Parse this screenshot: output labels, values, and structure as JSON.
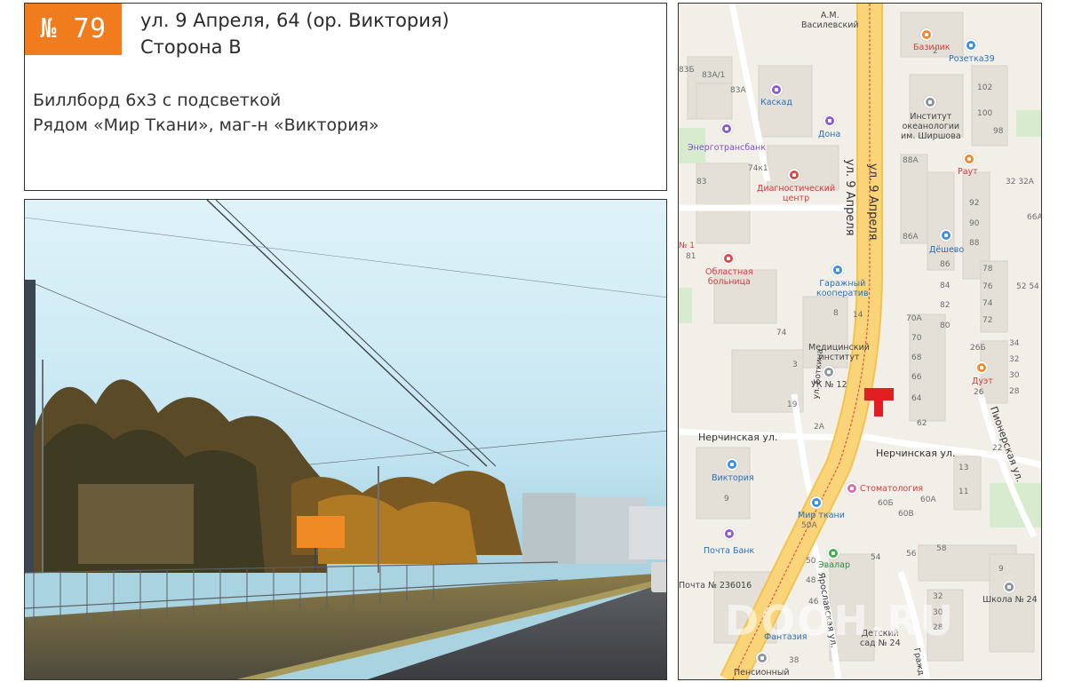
{
  "header": {
    "number": "№ 79",
    "address_line1": "ул. 9 Апреля, 64 (ор. Виктория)",
    "address_line2": "Сторона В",
    "description_line1": "Биллборд 6x3 с подсветкой",
    "description_line2": "Рядом «Мир Ткани», маг-н «Виктория»"
  },
  "colors": {
    "accent": "#f07c1e",
    "billboard": "#f08a24",
    "map_road": "#f9d479",
    "map_marker": "#e02020"
  },
  "map": {
    "streets": {
      "main": "ул. 9 Апреля",
      "nerchinskaya_left": "Нерчинская ул.",
      "nerchinskaya_right": "Нерчинская ул.",
      "pionerskaya": "Пионерская ул.",
      "botkina": "ул. Боткина",
      "yaroslavskaya": "Ярославская ул.",
      "grazhd": "Гражд"
    },
    "pois": {
      "vasilevsky": "А.М.\nВасилевский",
      "bazilik": "Базилик",
      "rozetka": "Розетка39",
      "kaskad": "Каскад",
      "dona": "Дона",
      "institute": "Институт\nокеанологии\nим. Ширшова",
      "energo": "Энерготрансбанк",
      "diagnost": "Диагностический\nцентр",
      "raut": "Раут",
      "deshevo": "Дёшево",
      "hospital": "Областная\nбольница",
      "garage": "Гаражный\nкооператив",
      "med_institute": "Медицинский\nинститут",
      "uk12": "УК № 12",
      "duet": "Дуэт",
      "viktoria": "Виктория",
      "stomatology": "Стоматология",
      "mir_tkani": "Мир ткани",
      "pochta_bank": "Почта Банк",
      "evalar": "Эвалар",
      "pochta": "Почта № 236016",
      "school": "Школа № 24",
      "fantasia": "Фантазия",
      "kindergarten": "Детский\nсад № 24",
      "pension": "Пенсионный"
    },
    "numbers": {
      "n83b": "83Б",
      "n83a1": "83А/1",
      "n83a": "83А",
      "n83": "83",
      "n74k1": "74к1",
      "n81": "81",
      "n74": "74",
      "n3": "3",
      "n19": "19",
      "n2a": "2А",
      "n8": "8",
      "n14": "14",
      "n88a": "88А",
      "n86a": "86А",
      "n86": "86",
      "n84": "84",
      "n82": "82",
      "n80": "80",
      "n70a": "70А",
      "n70": "70",
      "n68": "68",
      "n66": "66",
      "n64": "64",
      "n62": "62",
      "n2": "2",
      "n102": "102",
      "n100": "100",
      "n98": "98",
      "n92": "92",
      "n90": "90",
      "n88": "88",
      "n78": "78",
      "n76": "76",
      "n74b": "74",
      "n72": "72",
      "n26b": "26Б",
      "n26": "26",
      "n34": "34",
      "n32": "32",
      "n30": "30",
      "n28": "28",
      "n22": "22",
      "n13": "13",
      "n11": "11",
      "n60b": "60Б",
      "n60v": "60В",
      "n60a": "60А",
      "n50a": "50А",
      "n9": "9",
      "n9b": "9",
      "n56": "56",
      "n58": "58",
      "n54": "54",
      "n50": "50",
      "n48": "48",
      "n46": "46",
      "n32b": "32",
      "n30b": "30",
      "n28b": "28",
      "n38": "38",
      "n32_32a": "32  32А",
      "n66a": "66А",
      "n52_54": "52  54",
      "n1": "№ 1"
    },
    "watermark": "DOOH.RU"
  }
}
